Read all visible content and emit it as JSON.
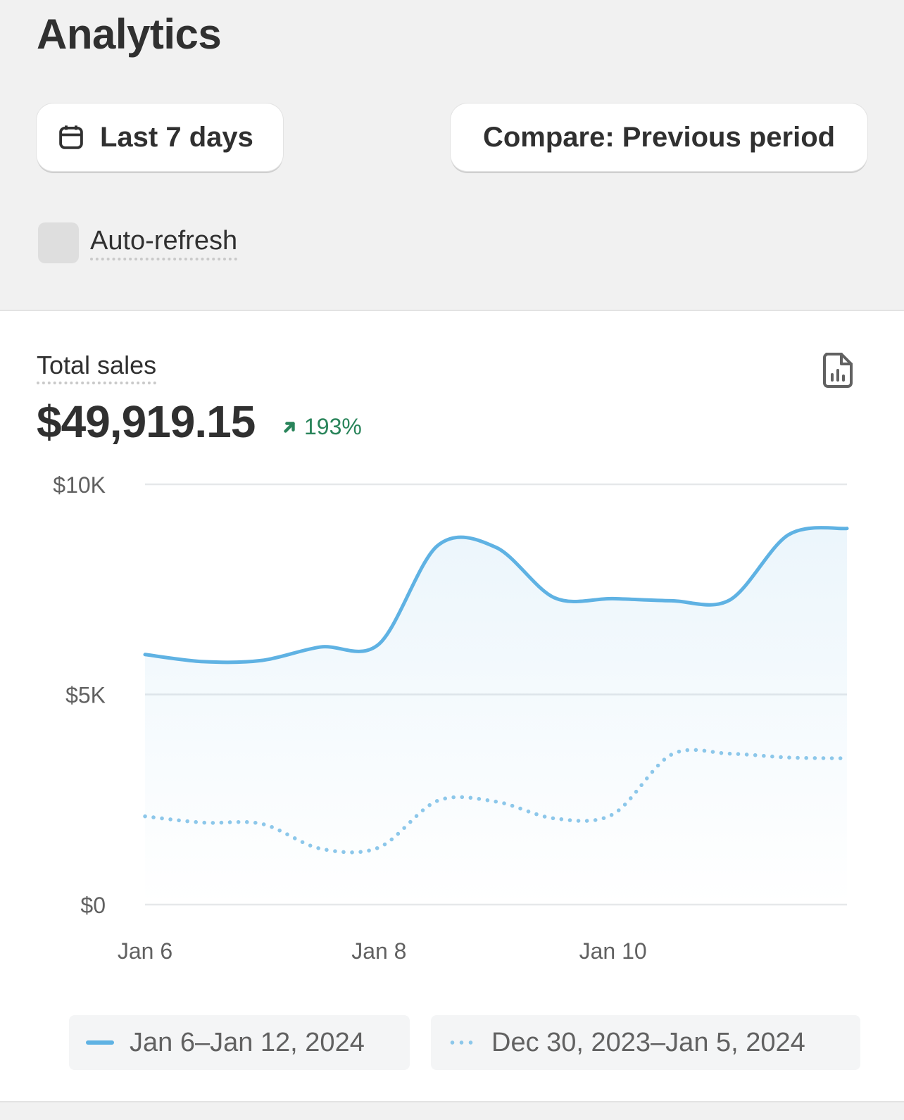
{
  "header": {
    "title": "Analytics"
  },
  "toolbar": {
    "date_range_label": "Last 7 days",
    "compare_label": "Compare: Previous period",
    "auto_refresh_label": "Auto-refresh",
    "auto_refresh_checked": false
  },
  "card": {
    "metric_label": "Total sales",
    "metric_value": "$49,919.15",
    "metric_change": "193%",
    "metric_change_direction": "up",
    "icon": "report-icon"
  },
  "colors": {
    "current_series": "#5fb2e3",
    "previous_series": "#8cc7ea",
    "positive_change": "#29845a"
  },
  "chart_data": {
    "type": "line",
    "title": "",
    "xlabel": "",
    "ylabel": "",
    "ylim": [
      0,
      10000
    ],
    "y_ticks": [
      {
        "value": 0,
        "label": "$0"
      },
      {
        "value": 5000,
        "label": "$5K"
      },
      {
        "value": 10000,
        "label": "$10K"
      }
    ],
    "x_ticks": [
      {
        "index": 0,
        "label": "Jan 6"
      },
      {
        "index": 2,
        "label": "Jan 8"
      },
      {
        "index": 4,
        "label": "Jan 10"
      }
    ],
    "grid": true,
    "legend_placement": "bottom",
    "series": [
      {
        "name": "Jan 6–Jan 12, 2024",
        "style": "solid",
        "area_fill": true,
        "points": [
          [
            0,
            5950
          ],
          [
            0.5,
            5780
          ],
          [
            1,
            5810
          ],
          [
            1.5,
            6130
          ],
          [
            2,
            6200
          ],
          [
            2.5,
            8540
          ],
          [
            3,
            8500
          ],
          [
            3.5,
            7300
          ],
          [
            4,
            7280
          ],
          [
            4.5,
            7230
          ],
          [
            5,
            7250
          ],
          [
            5.5,
            8800
          ],
          [
            6,
            8950
          ]
        ]
      },
      {
        "name": "Dec 30, 2023–Jan 5, 2024",
        "style": "dotted",
        "area_fill": false,
        "points": [
          [
            0,
            2100
          ],
          [
            0.5,
            1950
          ],
          [
            1,
            1920
          ],
          [
            1.5,
            1330
          ],
          [
            2,
            1360
          ],
          [
            2.5,
            2470
          ],
          [
            3,
            2450
          ],
          [
            3.5,
            2050
          ],
          [
            4,
            2150
          ],
          [
            4.5,
            3570
          ],
          [
            5,
            3590
          ],
          [
            5.5,
            3500
          ],
          [
            6,
            3480
          ]
        ]
      }
    ]
  }
}
